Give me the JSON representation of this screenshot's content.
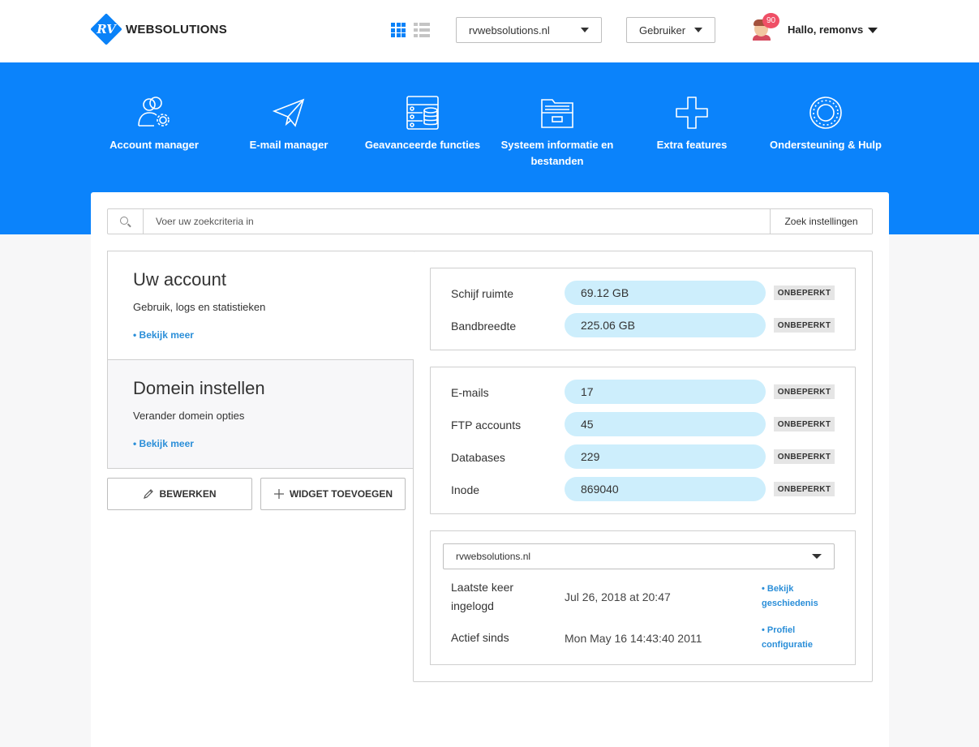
{
  "header": {
    "logo_text": "WEBSOLUTIONS",
    "logo_mark": "RV",
    "domain_select": "rvwebsolutions.nl",
    "role_select": "Gebruiker",
    "notification_count": "90",
    "greeting": "Hallo, remonvs"
  },
  "nav": [
    {
      "label": "Account manager",
      "icon": "account-manager-icon"
    },
    {
      "label": "E-mail manager",
      "icon": "paper-plane-icon"
    },
    {
      "label": "Geavanceerde functies",
      "icon": "server-icon"
    },
    {
      "label": "Systeem informatie en bestanden",
      "icon": "folder-icon"
    },
    {
      "label": "Extra features",
      "icon": "plus-icon"
    },
    {
      "label": "Ondersteuning & Hulp",
      "icon": "lifebuoy-icon"
    }
  ],
  "search": {
    "placeholder": "Voer uw zoekcriteria in",
    "button": "Zoek instellingen"
  },
  "widgets": [
    {
      "title": "Uw account",
      "subtitle": "Gebruik, logs en statistieken",
      "link": "• Bekijk meer"
    },
    {
      "title": "Domein instellen",
      "subtitle": "Verander domein opties",
      "link": "• Bekijk meer"
    }
  ],
  "buttons": {
    "edit": "BEWERKEN",
    "add_widget": "WIDGET TOEVOEGEN"
  },
  "usage_primary": [
    {
      "label": "Schijf ruimte",
      "value": "69.12 GB",
      "limit": "ONBEPERKT"
    },
    {
      "label": "Bandbreedte",
      "value": "225.06 GB",
      "limit": "ONBEPERKT"
    }
  ],
  "usage_secondary": [
    {
      "label": "E-mails",
      "value": "17",
      "limit": "ONBEPERKT"
    },
    {
      "label": "FTP accounts",
      "value": "45",
      "limit": "ONBEPERKT"
    },
    {
      "label": "Databases",
      "value": "229",
      "limit": "ONBEPERKT"
    },
    {
      "label": "Inode",
      "value": "869040",
      "limit": "ONBEPERKT"
    }
  ],
  "login_info": {
    "domain_select": "rvwebsolutions.nl",
    "last_login_label": "Laatste keer ingelogd",
    "last_login_value": "Jul 26, 2018 at 20:47",
    "last_login_link": "• Bekijk geschiedenis",
    "active_since_label": "Actief sinds",
    "active_since_value": "Mon May 16 14:43:40 2011",
    "active_since_link": "• Profiel configuratie"
  },
  "colors": {
    "brand_blue": "#0b83fb",
    "pill": "#cdeefc",
    "link": "#2a8ed8",
    "badge": "#ef4f66"
  }
}
